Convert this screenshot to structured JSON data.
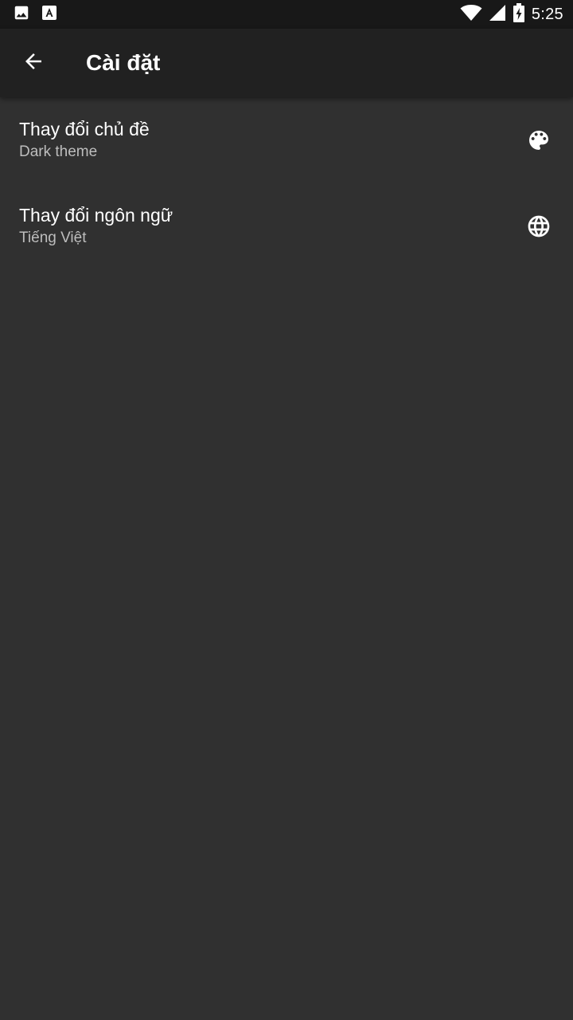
{
  "status_bar": {
    "time": "5:25",
    "left_icons": [
      "image-icon",
      "app-a-icon"
    ],
    "right_icons": [
      "wifi-icon",
      "cell-signal-icon",
      "battery-charging-icon"
    ]
  },
  "app_bar": {
    "title": "Cài đặt",
    "back_icon": "arrow-back-icon"
  },
  "settings": {
    "items": [
      {
        "title": "Thay đổi chủ đề",
        "subtitle": "Dark theme",
        "icon": "palette-icon"
      },
      {
        "title": "Thay đổi ngôn ngữ",
        "subtitle": "Tiếng Việt",
        "icon": "globe-icon"
      }
    ]
  },
  "colors": {
    "background": "#303030",
    "app_bar": "#212121",
    "status_bar": "#181818",
    "text_primary": "#ffffff",
    "text_secondary": "#bdbdbd"
  }
}
